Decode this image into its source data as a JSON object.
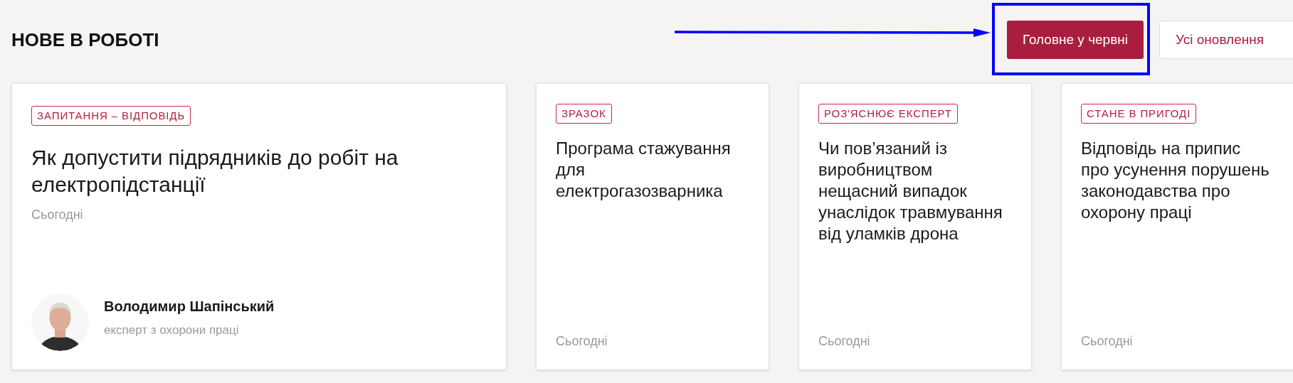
{
  "section": {
    "title": "НОВЕ В РОБОТІ"
  },
  "buttons": [
    {
      "label": "Головне у червні",
      "selected": true,
      "highlighted": true
    },
    {
      "label": "Усі оновлення",
      "selected": false,
      "highlighted": false
    }
  ],
  "cards": [
    {
      "kind": "featured",
      "tag": "ЗАПИТАННЯ – ВІДПОВІДЬ",
      "title": "Як допустити підрядників до робіт на електропідстанції",
      "date": "Сьогодні",
      "author": {
        "name": "Володимир Шапінський",
        "role": "експерт з охорони праці"
      }
    },
    {
      "kind": "standard",
      "tag": "ЗРАЗОК",
      "title": "Програма стажування для електрогазозварника",
      "date": "Сьогодні"
    },
    {
      "kind": "standard",
      "tag": "РОЗ'ЯСНЮЄ ЕКСПЕРТ",
      "title": "Чи пов’язаний із виробництвом нещасний випадок унаслідок травмування від уламків дрона",
      "date": "Сьогодні"
    },
    {
      "kind": "standard",
      "tag": "СТАНЕ В ПРИГОДІ",
      "title": "Відповідь на припис про усунення порушень законодавства про охорону праці",
      "date": "Сьогодні"
    }
  ]
}
